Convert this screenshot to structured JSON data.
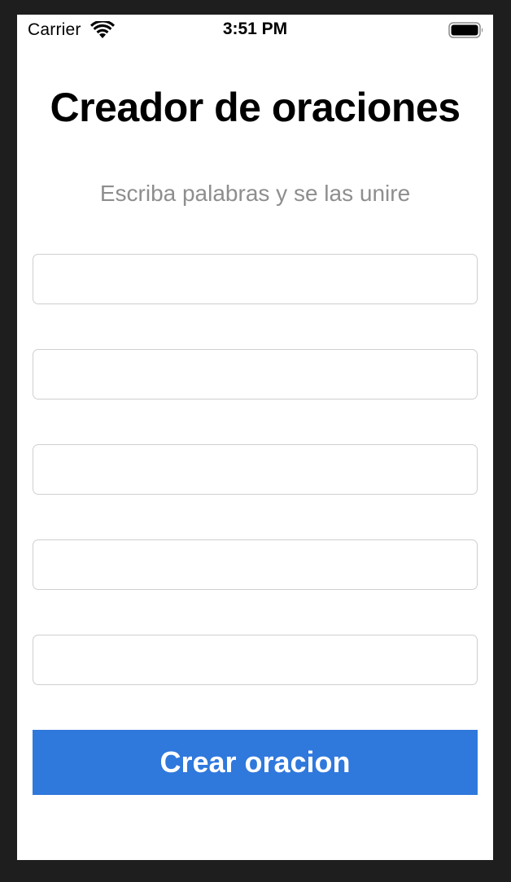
{
  "status_bar": {
    "carrier": "Carrier",
    "time": "3:51 PM",
    "wifi_icon": "wifi-icon",
    "battery_icon": "battery-icon"
  },
  "screen": {
    "title": "Creador de oraciones",
    "subtitle": "Escriba palabras y se las unire",
    "fields": [
      {
        "value": "",
        "placeholder": ""
      },
      {
        "value": "",
        "placeholder": ""
      },
      {
        "value": "",
        "placeholder": ""
      },
      {
        "value": "",
        "placeholder": ""
      },
      {
        "value": "",
        "placeholder": ""
      }
    ],
    "button_label": "Crear oracion"
  },
  "colors": {
    "button_background": "#2f78dc",
    "subtitle_text": "#8e8e8e",
    "field_border": "#cfcfcf",
    "outer_background": "#1e1e1e"
  }
}
